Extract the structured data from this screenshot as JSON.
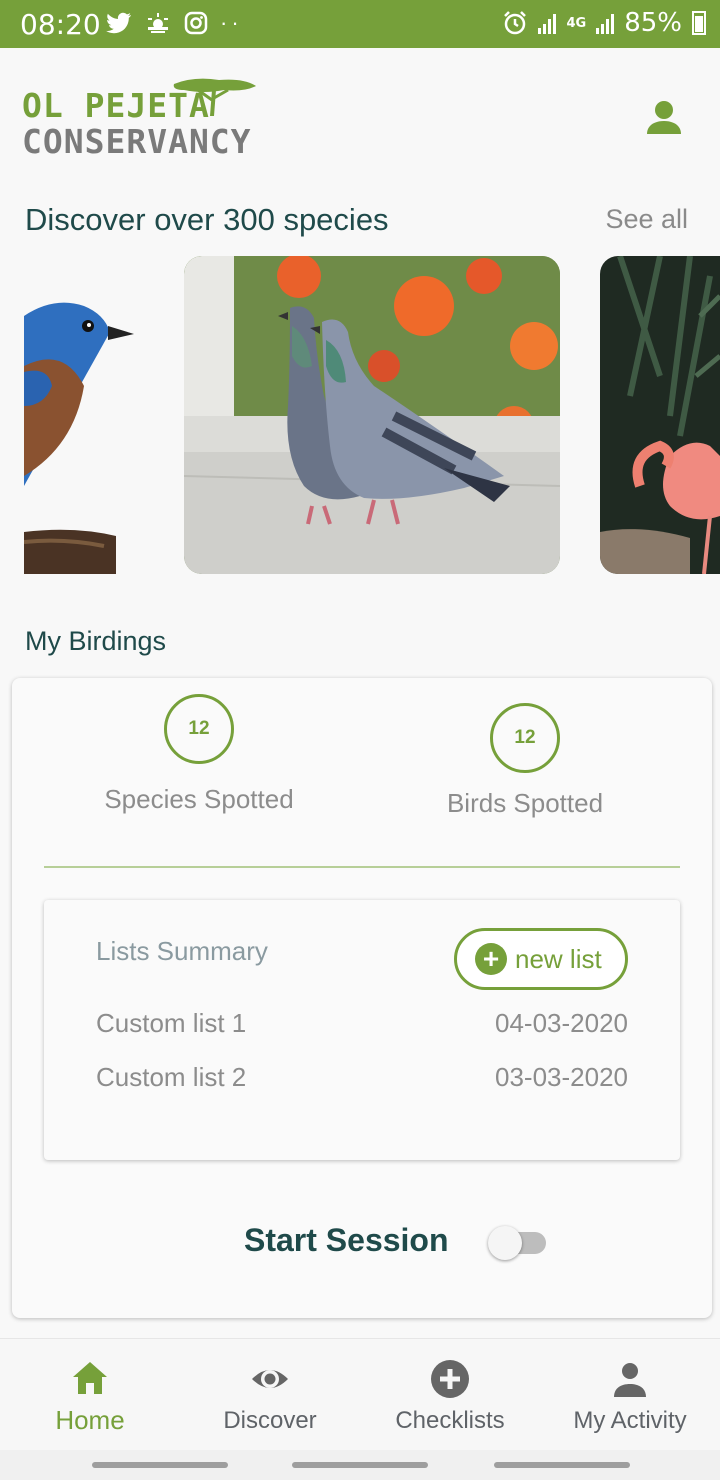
{
  "status_bar": {
    "time": "08:20",
    "network_label": "4G",
    "battery": "85%"
  },
  "header": {
    "logo_line1": "OL PEJETA",
    "logo_line2": "CONSERVANCY"
  },
  "discover": {
    "title": "Discover over 300 species",
    "see_all": "See all",
    "cards": [
      "bluebird",
      "pigeons",
      "flamingo"
    ]
  },
  "my_birdings": {
    "title": "My Birdings",
    "species_count": "12",
    "species_label": "Species Spotted",
    "birds_count": "12",
    "birds_label": "Birds Spotted",
    "lists_title": "Lists Summary",
    "new_list_label": "new list",
    "lists": [
      {
        "name": "Custom list 1",
        "date": "04-03-2020"
      },
      {
        "name": "Custom list 2",
        "date": "03-03-2020"
      }
    ],
    "session_label": "Start Session",
    "session_on": false
  },
  "bottom_nav": [
    {
      "label": "Home",
      "icon": "home-icon",
      "active": true
    },
    {
      "label": "Discover",
      "icon": "eye-icon",
      "active": false
    },
    {
      "label": "Checklists",
      "icon": "plus-circle-icon",
      "active": false
    },
    {
      "label": "My Activity",
      "icon": "person-icon",
      "active": false
    }
  ],
  "colors": {
    "accent": "#76a03a",
    "heading": "#1f4a4a",
    "muted": "#8c8c8c"
  }
}
